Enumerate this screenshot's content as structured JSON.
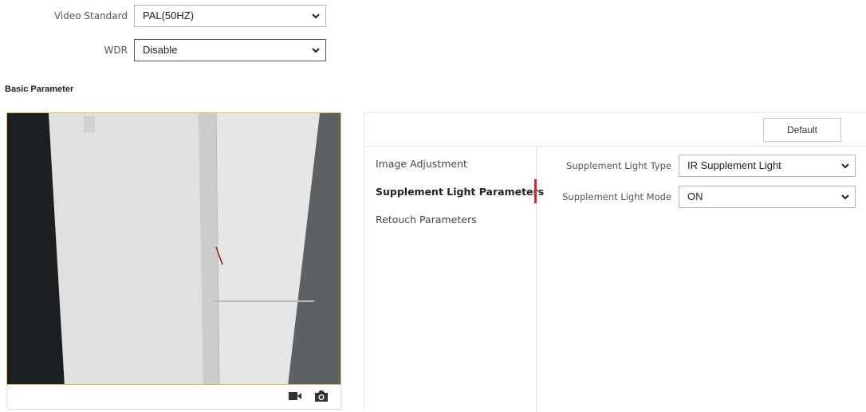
{
  "top_settings": {
    "video_standard": {
      "label": "Video Standard",
      "value": "PAL(50HZ)"
    },
    "wdr": {
      "label": "WDR",
      "value": "Disable"
    }
  },
  "section_title": "Basic Parameter",
  "preview": {
    "icons": [
      "record-icon",
      "capture-icon"
    ]
  },
  "panel": {
    "default_button": "Default",
    "menu": [
      {
        "label": "Image Adjustment",
        "active": false
      },
      {
        "label": "Supplement Light Parameters",
        "active": true
      },
      {
        "label": "Retouch Parameters",
        "active": false
      }
    ],
    "fields": {
      "light_type": {
        "label": "Supplement Light Type",
        "value": "IR Supplement Light"
      },
      "light_mode": {
        "label": "Supplement Light Mode",
        "value": "ON"
      }
    }
  },
  "colors": {
    "accent": "#d9232e",
    "preview_border": "#e3c34a"
  }
}
